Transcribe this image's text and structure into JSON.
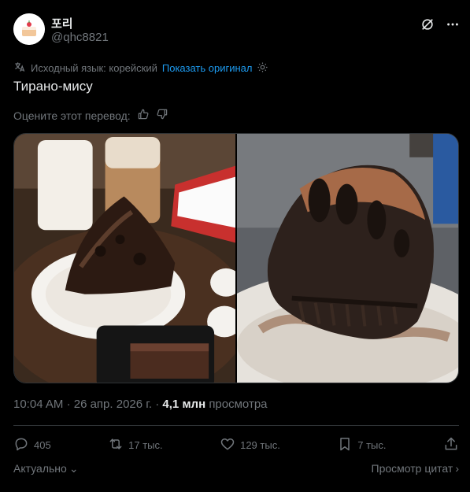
{
  "author": {
    "name": "포리",
    "handle": "@qhc8821"
  },
  "translation": {
    "source_label": "Исходный язык: корейский",
    "show_original": "Показать оригинал"
  },
  "tweet": {
    "text": "Тирано-мису"
  },
  "rating": {
    "label": "Оцените этот перевод:"
  },
  "meta": {
    "time": "10:04 AM",
    "date": "26 апр. 2026 г.",
    "views_count": "4,1 млн",
    "views_label": "просмотра"
  },
  "actions": {
    "replies": "405",
    "reposts": "17 тыс.",
    "likes": "129 тыс.",
    "bookmarks": "7 тыс."
  },
  "footer": {
    "sort_label": "Актуально",
    "quotes_label": "Просмотр цитат"
  },
  "colors": {
    "accent": "#1d9bf0",
    "background": "#000000",
    "muted": "#71767b",
    "text": "#e7e9ea"
  }
}
